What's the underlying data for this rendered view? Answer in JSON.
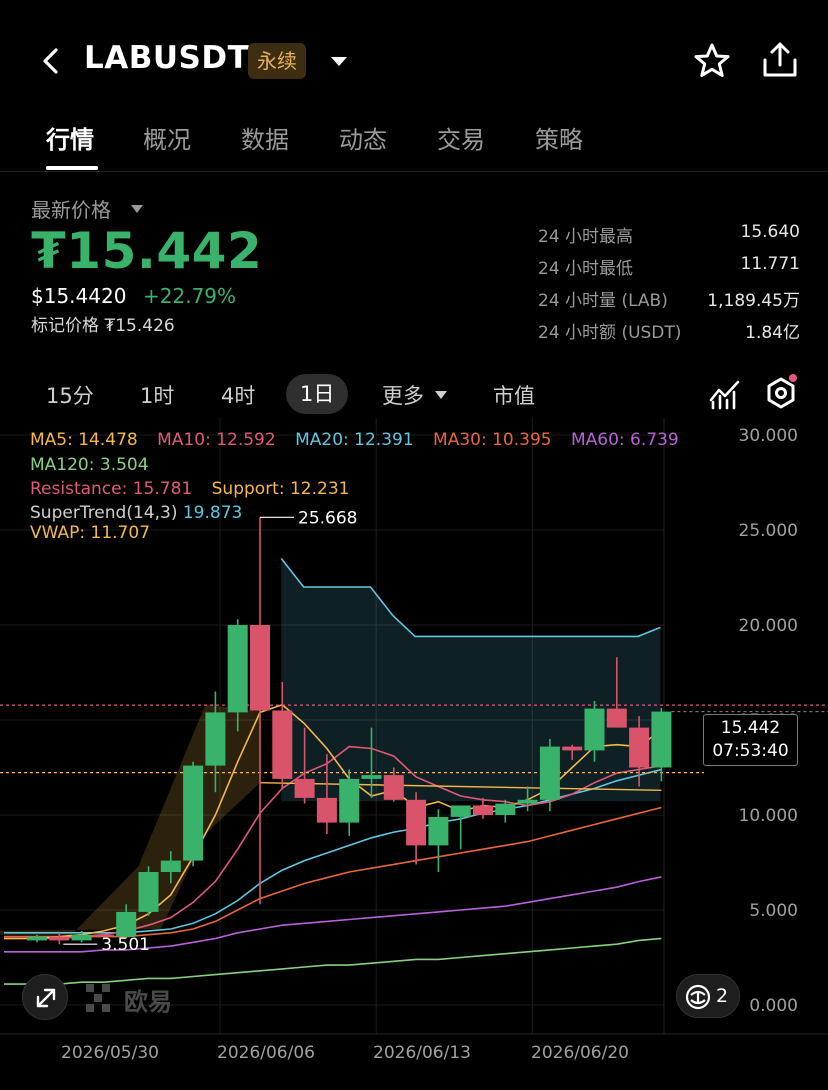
{
  "header": {
    "title": "LABUSDT",
    "badge": "永续"
  },
  "tabs": [
    "行情",
    "概况",
    "数据",
    "动态",
    "交易",
    "策略"
  ],
  "price": {
    "label": "最新价格",
    "main": "₮15.442",
    "usd": "$15.4420",
    "change": "+22.79%",
    "mark": "标记价格 ₮15.426"
  },
  "stats": [
    {
      "label": "24 小时最高",
      "value": "15.640"
    },
    {
      "label": "24 小时最低",
      "value": "11.771"
    },
    {
      "label": "24 小时量 (LAB)",
      "value": "1,189.45万"
    },
    {
      "label": "24 小时额 (USDT)",
      "value": "1.84亿"
    }
  ],
  "intervals": [
    "15分",
    "1时",
    "4时",
    "1日",
    "更多",
    "市值"
  ],
  "legend": {
    "ma5": "MA5: 14.478",
    "ma10": "MA10: 12.592",
    "ma20": "MA20: 12.391",
    "ma30": "MA30: 10.395",
    "ma60": "MA60: 6.739",
    "ma120": "MA120: 3.504",
    "resistance": "Resistance: 15.781",
    "support": "Support: 12.231",
    "supertrend": "SuperTrend(14,3)",
    "supertrend_value": "19.873",
    "vwap": "VWAP: 11.707"
  },
  "colors": {
    "up": "#39b36b",
    "down": "#d9546b",
    "ma5": "#f5b84a",
    "ma10": "#e05a78",
    "ma20": "#5fc7e0",
    "ma30": "#e8663c",
    "ma60": "#b763d6",
    "ma120": "#8ad17f",
    "resistance": "#e05a78",
    "support": "#f5b84a"
  },
  "chart_data": {
    "type": "candlestick",
    "y_axis_labels": [
      "30.000",
      "25.000",
      "20.000",
      "15.000",
      "10.000",
      "5.000",
      "0.000"
    ],
    "ylim": [
      0,
      30
    ],
    "x_axis_labels": [
      "2026/05/30",
      "2026/06/06",
      "2026/06/13",
      "2026/06/20"
    ],
    "annotations": {
      "high": "25.668",
      "low": "3.501"
    },
    "current": {
      "price": "15.442",
      "countdown": "07:53:40"
    },
    "candles": [
      {
        "o": 3.4,
        "h": 3.7,
        "l": 3.3,
        "c": 3.6
      },
      {
        "o": 3.6,
        "h": 3.8,
        "l": 3.2,
        "c": 3.4
      },
      {
        "o": 3.4,
        "h": 3.9,
        "l": 3.3,
        "c": 3.7
      },
      {
        "o": 3.7,
        "h": 3.8,
        "l": 3.5,
        "c": 3.6
      },
      {
        "o": 3.6,
        "h": 5.3,
        "l": 3.5,
        "c": 4.9
      },
      {
        "o": 4.9,
        "h": 7.3,
        "l": 4.7,
        "c": 7.0
      },
      {
        "o": 7.0,
        "h": 8.1,
        "l": 6.4,
        "c": 7.6
      },
      {
        "o": 7.6,
        "h": 12.8,
        "l": 7.3,
        "c": 12.6
      },
      {
        "o": 12.6,
        "h": 16.5,
        "l": 11.2,
        "c": 15.4
      },
      {
        "o": 15.4,
        "h": 20.3,
        "l": 14.4,
        "c": 20.0
      },
      {
        "o": 20.0,
        "h": 25.668,
        "l": 5.3,
        "c": 15.5
      },
      {
        "o": 15.5,
        "h": 17.0,
        "l": 11.4,
        "c": 11.9
      },
      {
        "o": 11.9,
        "h": 14.6,
        "l": 10.6,
        "c": 10.9
      },
      {
        "o": 10.9,
        "h": 13.2,
        "l": 9.0,
        "c": 9.6
      },
      {
        "o": 9.6,
        "h": 12.4,
        "l": 8.9,
        "c": 11.9
      },
      {
        "o": 11.9,
        "h": 14.6,
        "l": 10.9,
        "c": 12.1
      },
      {
        "o": 12.1,
        "h": 12.5,
        "l": 10.7,
        "c": 10.8
      },
      {
        "o": 10.8,
        "h": 11.2,
        "l": 7.4,
        "c": 8.4
      },
      {
        "o": 8.4,
        "h": 10.3,
        "l": 7.0,
        "c": 9.9
      },
      {
        "o": 9.9,
        "h": 10.5,
        "l": 8.2,
        "c": 10.5
      },
      {
        "o": 10.5,
        "h": 10.9,
        "l": 9.8,
        "c": 10.0
      },
      {
        "o": 10.0,
        "h": 10.8,
        "l": 9.6,
        "c": 10.6
      },
      {
        "o": 10.6,
        "h": 11.5,
        "l": 10.2,
        "c": 10.8
      },
      {
        "o": 10.8,
        "h": 14.0,
        "l": 10.2,
        "c": 13.6
      },
      {
        "o": 13.6,
        "h": 13.7,
        "l": 12.9,
        "c": 13.4
      },
      {
        "o": 13.4,
        "h": 16.0,
        "l": 12.8,
        "c": 15.6
      },
      {
        "o": 15.6,
        "h": 18.3,
        "l": 14.6,
        "c": 14.6
      },
      {
        "o": 14.6,
        "h": 15.2,
        "l": 11.5,
        "c": 12.5
      },
      {
        "o": 12.5,
        "h": 15.64,
        "l": 11.771,
        "c": 15.442
      }
    ],
    "ma5": [
      3.5,
      3.6,
      3.7,
      3.9,
      4.2,
      4.8,
      5.8,
      7.8,
      10.0,
      12.8,
      15.4,
      15.8,
      14.8,
      13.5,
      11.9,
      11.0,
      11.3,
      10.4,
      10.7,
      10.2,
      10.5,
      10.4,
      10.8,
      11.4,
      12.5,
      13.6,
      13.7,
      13.6,
      14.478
    ],
    "ma10": [
      3.5,
      3.5,
      3.6,
      3.7,
      3.9,
      4.2,
      4.6,
      5.4,
      6.5,
      8.2,
      10.1,
      11.4,
      12.2,
      12.7,
      13.6,
      13.5,
      13.1,
      12.0,
      11.5,
      11.0,
      10.8,
      10.7,
      10.5,
      10.7,
      11.1,
      11.7,
      12.2,
      12.4,
      12.592
    ],
    "ma20": [
      3.8,
      3.8,
      3.8,
      3.8,
      3.8,
      3.9,
      4.0,
      4.3,
      4.8,
      5.5,
      6.4,
      7.1,
      7.6,
      8.0,
      8.4,
      8.8,
      9.1,
      9.3,
      9.6,
      9.8,
      10.1,
      10.3,
      10.5,
      10.8,
      11.1,
      11.4,
      11.8,
      12.1,
      12.391
    ],
    "ma30": [
      3.6,
      3.6,
      3.6,
      3.6,
      3.6,
      3.7,
      3.8,
      4.0,
      4.4,
      5.0,
      5.6,
      6.0,
      6.4,
      6.7,
      7.0,
      7.2,
      7.4,
      7.6,
      7.8,
      8.0,
      8.2,
      8.4,
      8.6,
      8.9,
      9.2,
      9.5,
      9.8,
      10.1,
      10.395
    ],
    "ma60": [
      2.8,
      2.8,
      2.8,
      2.9,
      2.9,
      3.0,
      3.1,
      3.3,
      3.5,
      3.8,
      4.0,
      4.2,
      4.3,
      4.4,
      4.5,
      4.6,
      4.7,
      4.8,
      4.9,
      5.0,
      5.1,
      5.2,
      5.4,
      5.6,
      5.8,
      6.0,
      6.2,
      6.5,
      6.739
    ],
    "ma120": [
      1.1,
      1.1,
      1.2,
      1.2,
      1.3,
      1.4,
      1.4,
      1.5,
      1.6,
      1.7,
      1.8,
      1.9,
      2.0,
      2.1,
      2.1,
      2.2,
      2.3,
      2.4,
      2.4,
      2.5,
      2.6,
      2.7,
      2.8,
      2.9,
      3.0,
      3.1,
      3.2,
      3.4,
      3.504
    ],
    "supertrend": {
      "start_index": 11,
      "values": [
        23.5,
        22.0,
        22.0,
        22.0,
        22.0,
        20.5,
        19.4,
        19.4,
        19.4,
        19.4,
        19.4,
        19.4,
        19.4,
        19.4,
        19.4,
        19.4,
        19.4,
        19.873
      ]
    },
    "resistance": 15.781,
    "support": 12.231
  },
  "logo": "欧易",
  "overlay_count": "2"
}
